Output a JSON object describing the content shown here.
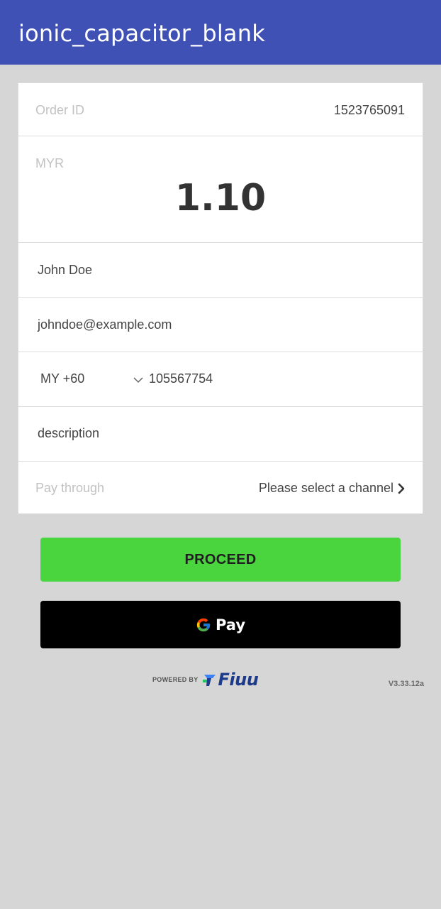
{
  "appbar": {
    "title": "ionic_capacitor_blank",
    "color": "#3f51b5"
  },
  "order": {
    "id_label": "Order ID",
    "id_value": "1523765091"
  },
  "amount": {
    "currency": "MYR",
    "value": "1.10"
  },
  "form": {
    "name_value": "John Doe",
    "email_value": "johndoe@example.com",
    "country_code": "MY +60",
    "phone_value": "105567754",
    "description_placeholder": "description"
  },
  "channel": {
    "label": "Pay through",
    "value": "Please select a channel"
  },
  "buttons": {
    "proceed_label": "PROCEED",
    "proceed_color": "#4ad53f",
    "gpay_label": "Pay"
  },
  "footer": {
    "powered_by": "POWERED BY",
    "brand": "Fiuu",
    "version": "V3.33.12a"
  },
  "icons": {
    "country_dropdown": "chevron-down-icon",
    "channel_arrow": "chevron-right-icon",
    "google": "google-g-icon",
    "brand": "fiuu-logo-icon"
  }
}
